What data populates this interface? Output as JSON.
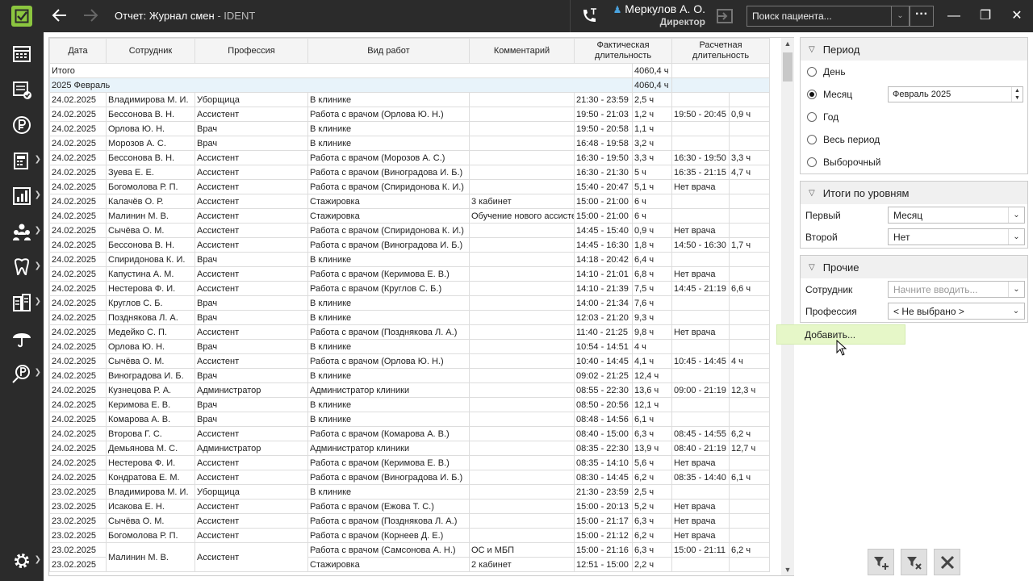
{
  "window": {
    "title": "Отчет: Журнал смен",
    "app_name": " - IDENT",
    "user": {
      "name": "Меркулов А. О.",
      "role": "Директор"
    },
    "search": {
      "placeholder": "Поиск пациента..."
    },
    "more_label": "···",
    "back_icon": "arrow-left-icon",
    "forward_icon": "arrow-right-icon"
  },
  "sidebar": {
    "items": [
      {
        "icon": "calendar-grid-icon"
      },
      {
        "icon": "schedule-check-icon"
      },
      {
        "icon": "ruble-icon"
      },
      {
        "icon": "cash-register-icon"
      },
      {
        "icon": "reports-chart-icon"
      },
      {
        "icon": "staff-group-icon"
      },
      {
        "icon": "tooth-icon"
      },
      {
        "icon": "warehouse-icon"
      },
      {
        "icon": "insurance-umbrella-icon"
      },
      {
        "icon": "finance-icon"
      }
    ],
    "settings_icon": "gear-icon"
  },
  "table": {
    "columns": [
      "Дата",
      "Сотрудник",
      "Профессия",
      "Вид работ",
      "Комментарий",
      "Фактическая длительность",
      "Расчетная длительность"
    ],
    "total": {
      "label": "Итого",
      "value": "4060,4 ч"
    },
    "group": {
      "label": "2025 Февраль",
      "value": "4060,4 ч"
    },
    "rows": [
      [
        "24.02.2025",
        "Владимирова М. И.",
        "Уборщица",
        "В клинике",
        "",
        "21:30 - 23:59",
        "2,5 ч",
        "",
        ""
      ],
      [
        "24.02.2025",
        "Бессонова В. Н.",
        "Ассистент",
        "Работа с врачом (Орлова Ю. Н.)",
        "",
        "19:50 - 21:03",
        "1,2 ч",
        "19:50 - 20:45",
        "0,9 ч"
      ],
      [
        "24.02.2025",
        "Орлова Ю. Н.",
        "Врач",
        "В клинике",
        "",
        "19:50 - 20:58",
        "1,1 ч",
        "",
        ""
      ],
      [
        "24.02.2025",
        "Морозов А. С.",
        "Врач",
        "В клинике",
        "",
        "16:48 - 19:58",
        "3,2 ч",
        "",
        ""
      ],
      [
        "24.02.2025",
        "Бессонова В. Н.",
        "Ассистент",
        "Работа с врачом (Морозов А. С.)",
        "",
        "16:30 - 19:50",
        "3,3 ч",
        "16:30 - 19:50",
        "3,3 ч"
      ],
      [
        "24.02.2025",
        "Зуева Е. Е.",
        "Ассистент",
        "Работа с врачом (Виноградова И. Б.)",
        "",
        "16:30 - 21:30",
        "5 ч",
        "16:35 - 21:15",
        "4,7 ч"
      ],
      [
        "24.02.2025",
        "Богомолова Р. П.",
        "Ассистент",
        "Работа с врачом (Спиридонова К. И.)",
        "",
        "15:40 - 20:47",
        "5,1 ч",
        "Нет врача",
        ""
      ],
      [
        "24.02.2025",
        "Калачёв О. Р.",
        "Ассистент",
        "Стажировка",
        "3 кабинет",
        "15:00 - 21:00",
        "6 ч",
        "",
        ""
      ],
      [
        "24.02.2025",
        "Малинин М. В.",
        "Ассистент",
        "Стажировка",
        "Обучение нового ассистента",
        "15:00 - 21:00",
        "6 ч",
        "",
        ""
      ],
      [
        "24.02.2025",
        "Сычёва О. М.",
        "Ассистент",
        "Работа с врачом (Спиридонова К. И.)",
        "",
        "14:45 - 15:40",
        "0,9 ч",
        "Нет врача",
        ""
      ],
      [
        "24.02.2025",
        "Бессонова В. Н.",
        "Ассистент",
        "Работа с врачом (Виноградова И. Б.)",
        "",
        "14:45 - 16:30",
        "1,8 ч",
        "14:50 - 16:30",
        "1,7 ч"
      ],
      [
        "24.02.2025",
        "Спиридонова К. И.",
        "Врач",
        "В клинике",
        "",
        "14:18 - 20:42",
        "6,4 ч",
        "",
        ""
      ],
      [
        "24.02.2025",
        "Капустина А. М.",
        "Ассистент",
        "Работа с врачом (Керимова Е. В.)",
        "",
        "14:10 - 21:01",
        "6,8 ч",
        "Нет врача",
        ""
      ],
      [
        "24.02.2025",
        "Нестерова Ф. И.",
        "Ассистент",
        "Работа с врачом (Круглов С. Б.)",
        "",
        "14:10 - 21:39",
        "7,5 ч",
        "14:45 - 21:19",
        "6,6 ч"
      ],
      [
        "24.02.2025",
        "Круглов С. Б.",
        "Врач",
        "В клинике",
        "",
        "14:00 - 21:34",
        "7,6 ч",
        "",
        ""
      ],
      [
        "24.02.2025",
        "Позднякова Л. А.",
        "Врач",
        "В клинике",
        "",
        "12:03 - 21:20",
        "9,3 ч",
        "",
        ""
      ],
      [
        "24.02.2025",
        "Медейко С. П.",
        "Ассистент",
        "Работа с врачом (Позднякова Л. А.)",
        "",
        "11:40 - 21:25",
        "9,8 ч",
        "Нет врача",
        ""
      ],
      [
        "24.02.2025",
        "Орлова Ю. Н.",
        "Врач",
        "В клинике",
        "",
        "10:54 - 14:51",
        "4 ч",
        "",
        ""
      ],
      [
        "24.02.2025",
        "Сычёва О. М.",
        "Ассистент",
        "Работа с врачом (Орлова Ю. Н.)",
        "",
        "10:40 - 14:45",
        "4,1 ч",
        "10:45 - 14:45",
        "4 ч"
      ],
      [
        "24.02.2025",
        "Виноградова И. Б.",
        "Врач",
        "В клинике",
        "",
        "09:02 - 21:25",
        "12,4 ч",
        "",
        ""
      ],
      [
        "24.02.2025",
        "Кузнецова Р. А.",
        "Администратор",
        "Администратор клиники",
        "",
        "08:55 - 22:30",
        "13,6 ч",
        "09:00 - 21:19",
        "12,3 ч"
      ],
      [
        "24.02.2025",
        "Керимова Е. В.",
        "Врач",
        "В клинике",
        "",
        "08:50 - 20:56",
        "12,1 ч",
        "",
        ""
      ],
      [
        "24.02.2025",
        "Комарова А. В.",
        "Врач",
        "В клинике",
        "",
        "08:48 - 14:56",
        "6,1 ч",
        "",
        ""
      ],
      [
        "24.02.2025",
        "Второва Г. С.",
        "Ассистент",
        "Работа с врачом (Комарова А. В.)",
        "",
        "08:40 - 15:00",
        "6,3 ч",
        "08:45 - 14:55",
        "6,2 ч"
      ],
      [
        "24.02.2025",
        "Демьянова М. С.",
        "Администратор",
        "Администратор клиники",
        "",
        "08:35 - 22:30",
        "13,9 ч",
        "08:40 - 21:19",
        "12,7 ч"
      ],
      [
        "24.02.2025",
        "Нестерова Ф. И.",
        "Ассистент",
        "Работа с врачом (Керимова Е. В.)",
        "",
        "08:35 - 14:10",
        "5,6 ч",
        "Нет врача",
        ""
      ],
      [
        "24.02.2025",
        "Кондратова Е. М.",
        "Ассистент",
        "Работа с врачом (Виноградова И. Б.)",
        "",
        "08:30 - 14:45",
        "6,2 ч",
        "08:35 - 14:40",
        "6,1 ч"
      ],
      [
        "23.02.2025",
        "Владимирова М. И.",
        "Уборщица",
        "В клинике",
        "",
        "21:30 - 23:59",
        "2,5 ч",
        "",
        ""
      ],
      [
        "23.02.2025",
        "Исакова Е. Н.",
        "Ассистент",
        "Работа с врачом (Ежова Т. С.)",
        "",
        "15:00 - 20:13",
        "5,2 ч",
        "Нет врача",
        ""
      ],
      [
        "23.02.2025",
        "Сычёва О. М.",
        "Ассистент",
        "Работа с врачом (Позднякова Л. А.)",
        "",
        "15:00 - 21:17",
        "6,3 ч",
        "Нет врача",
        ""
      ],
      [
        "23.02.2025",
        "Богомолова Р. П.",
        "Ассистент",
        "Работа с врачом (Корнеев Д. Е.)",
        "",
        "15:00 - 21:12",
        "6,2 ч",
        "Нет врача",
        ""
      ]
    ],
    "merged_row": {
      "date1": "23.02.2025",
      "date2": "23.02.2025",
      "employee": "Малинин М. В.",
      "profession": "Ассистент",
      "sub1": [
        "Работа с врачом (Самсонова А. Н.)",
        "ОС и МБП",
        "15:00 - 21:16",
        "6,3 ч",
        "15:00 - 21:11",
        "6,2 ч"
      ],
      "sub2": [
        "Стажировка",
        "2 кабинет",
        "12:51 - 15:00",
        "2,2 ч",
        "",
        ""
      ]
    }
  },
  "filters": {
    "period": {
      "title": "Период",
      "options": [
        "День",
        "Месяц",
        "Год",
        "Весь период",
        "Выборочный"
      ],
      "selected": "Месяц",
      "month_value": "Февраль  2025"
    },
    "levels": {
      "title": "Итоги по уровням",
      "first_label": "Первый",
      "first_value": "Месяц",
      "second_label": "Второй",
      "second_value": "Нет"
    },
    "other": {
      "title": "Прочие",
      "employee_label": "Сотрудник",
      "employee_placeholder": "Начните вводить...",
      "profession_label": "Профессия",
      "profession_value": "< Не выбрано >"
    }
  },
  "popup": {
    "label": "Добавить..."
  },
  "bottom_buttons": [
    "filter-apply-icon",
    "filter-clear-icon",
    "close-x-icon"
  ],
  "colors": {
    "accent": "#8cc63f",
    "dark": "#2b2b2b",
    "group_row": "#e8f3fa",
    "popup": "#e6f7c8"
  }
}
